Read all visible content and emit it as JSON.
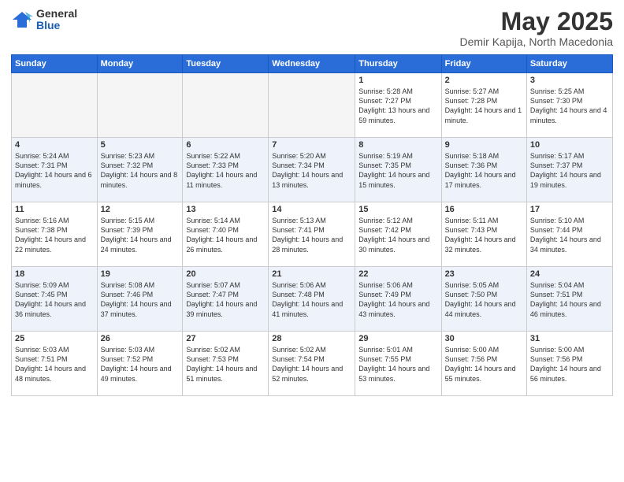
{
  "logo": {
    "general": "General",
    "blue": "Blue"
  },
  "title": "May 2025",
  "location": "Demir Kapija, North Macedonia",
  "weekdays": [
    "Sunday",
    "Monday",
    "Tuesday",
    "Wednesday",
    "Thursday",
    "Friday",
    "Saturday"
  ],
  "weeks": [
    [
      {
        "day": "",
        "empty": true
      },
      {
        "day": "",
        "empty": true
      },
      {
        "day": "",
        "empty": true
      },
      {
        "day": "",
        "empty": true
      },
      {
        "day": "1",
        "sunrise": "5:28 AM",
        "sunset": "7:27 PM",
        "daylight": "13 hours and 59 minutes."
      },
      {
        "day": "2",
        "sunrise": "5:27 AM",
        "sunset": "7:28 PM",
        "daylight": "14 hours and 1 minute."
      },
      {
        "day": "3",
        "sunrise": "5:25 AM",
        "sunset": "7:30 PM",
        "daylight": "14 hours and 4 minutes."
      }
    ],
    [
      {
        "day": "4",
        "sunrise": "5:24 AM",
        "sunset": "7:31 PM",
        "daylight": "14 hours and 6 minutes."
      },
      {
        "day": "5",
        "sunrise": "5:23 AM",
        "sunset": "7:32 PM",
        "daylight": "14 hours and 8 minutes."
      },
      {
        "day": "6",
        "sunrise": "5:22 AM",
        "sunset": "7:33 PM",
        "daylight": "14 hours and 11 minutes."
      },
      {
        "day": "7",
        "sunrise": "5:20 AM",
        "sunset": "7:34 PM",
        "daylight": "14 hours and 13 minutes."
      },
      {
        "day": "8",
        "sunrise": "5:19 AM",
        "sunset": "7:35 PM",
        "daylight": "14 hours and 15 minutes."
      },
      {
        "day": "9",
        "sunrise": "5:18 AM",
        "sunset": "7:36 PM",
        "daylight": "14 hours and 17 minutes."
      },
      {
        "day": "10",
        "sunrise": "5:17 AM",
        "sunset": "7:37 PM",
        "daylight": "14 hours and 19 minutes."
      }
    ],
    [
      {
        "day": "11",
        "sunrise": "5:16 AM",
        "sunset": "7:38 PM",
        "daylight": "14 hours and 22 minutes."
      },
      {
        "day": "12",
        "sunrise": "5:15 AM",
        "sunset": "7:39 PM",
        "daylight": "14 hours and 24 minutes."
      },
      {
        "day": "13",
        "sunrise": "5:14 AM",
        "sunset": "7:40 PM",
        "daylight": "14 hours and 26 minutes."
      },
      {
        "day": "14",
        "sunrise": "5:13 AM",
        "sunset": "7:41 PM",
        "daylight": "14 hours and 28 minutes."
      },
      {
        "day": "15",
        "sunrise": "5:12 AM",
        "sunset": "7:42 PM",
        "daylight": "14 hours and 30 minutes."
      },
      {
        "day": "16",
        "sunrise": "5:11 AM",
        "sunset": "7:43 PM",
        "daylight": "14 hours and 32 minutes."
      },
      {
        "day": "17",
        "sunrise": "5:10 AM",
        "sunset": "7:44 PM",
        "daylight": "14 hours and 34 minutes."
      }
    ],
    [
      {
        "day": "18",
        "sunrise": "5:09 AM",
        "sunset": "7:45 PM",
        "daylight": "14 hours and 36 minutes."
      },
      {
        "day": "19",
        "sunrise": "5:08 AM",
        "sunset": "7:46 PM",
        "daylight": "14 hours and 37 minutes."
      },
      {
        "day": "20",
        "sunrise": "5:07 AM",
        "sunset": "7:47 PM",
        "daylight": "14 hours and 39 minutes."
      },
      {
        "day": "21",
        "sunrise": "5:06 AM",
        "sunset": "7:48 PM",
        "daylight": "14 hours and 41 minutes."
      },
      {
        "day": "22",
        "sunrise": "5:06 AM",
        "sunset": "7:49 PM",
        "daylight": "14 hours and 43 minutes."
      },
      {
        "day": "23",
        "sunrise": "5:05 AM",
        "sunset": "7:50 PM",
        "daylight": "14 hours and 44 minutes."
      },
      {
        "day": "24",
        "sunrise": "5:04 AM",
        "sunset": "7:51 PM",
        "daylight": "14 hours and 46 minutes."
      }
    ],
    [
      {
        "day": "25",
        "sunrise": "5:03 AM",
        "sunset": "7:51 PM",
        "daylight": "14 hours and 48 minutes."
      },
      {
        "day": "26",
        "sunrise": "5:03 AM",
        "sunset": "7:52 PM",
        "daylight": "14 hours and 49 minutes."
      },
      {
        "day": "27",
        "sunrise": "5:02 AM",
        "sunset": "7:53 PM",
        "daylight": "14 hours and 51 minutes."
      },
      {
        "day": "28",
        "sunrise": "5:02 AM",
        "sunset": "7:54 PM",
        "daylight": "14 hours and 52 minutes."
      },
      {
        "day": "29",
        "sunrise": "5:01 AM",
        "sunset": "7:55 PM",
        "daylight": "14 hours and 53 minutes."
      },
      {
        "day": "30",
        "sunrise": "5:00 AM",
        "sunset": "7:56 PM",
        "daylight": "14 hours and 55 minutes."
      },
      {
        "day": "31",
        "sunrise": "5:00 AM",
        "sunset": "7:56 PM",
        "daylight": "14 hours and 56 minutes."
      }
    ]
  ]
}
